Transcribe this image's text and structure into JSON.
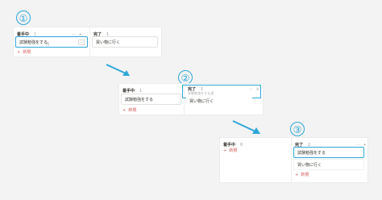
{
  "steps": [
    "①",
    "②",
    "③"
  ],
  "colors": {
    "accent": "#2ea7d8",
    "new_text": "#d8585b",
    "divider": "#e3e2e0"
  },
  "icons": {
    "menu": "…",
    "add": "+",
    "cursor": "☝"
  },
  "panel1": {
    "col_a": {
      "title": "着手中",
      "count": "1",
      "actions": "⋯ +",
      "card": "試験勉強をする",
      "card_menu": "⋯",
      "new": "新規"
    },
    "col_b": {
      "title": "完了",
      "count": "1",
      "card": "買い物に行く",
      "new": "新規"
    }
  },
  "panel2": {
    "col_a": {
      "title": "着手中",
      "count": "1",
      "card": "試験勉強をする",
      "new": "新規"
    },
    "col_b": {
      "title": "完了",
      "count": "1",
      "actions": "⋯ +",
      "ghost": "試験勉強をする",
      "card": "買い物に行く",
      "new": "新規"
    }
  },
  "panel3": {
    "col_a": {
      "title": "着手中",
      "count": "0",
      "new": "新規"
    },
    "col_b": {
      "title": "完了",
      "count": "2",
      "actions": "⋯ +",
      "card1": "試験勉強をする",
      "card2": "買い物に行く",
      "new": "新規"
    }
  }
}
